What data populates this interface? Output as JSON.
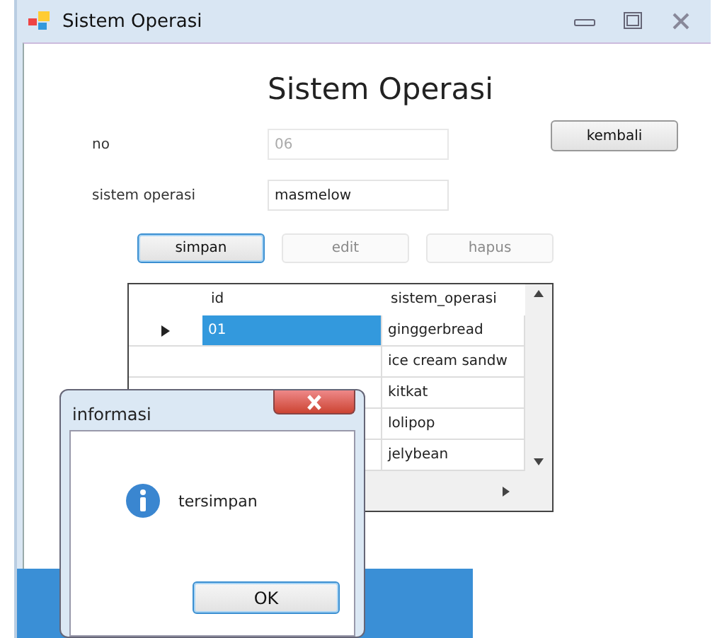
{
  "window": {
    "title": "Sistem Operasi"
  },
  "heading": "Sistem Operasi",
  "fields": [
    {
      "label": "no",
      "value": "06",
      "disabled": true
    },
    {
      "label": "sistem operasi",
      "value": "masmelow",
      "disabled": false
    }
  ],
  "back_button": {
    "label": "kembali"
  },
  "buttons": [
    {
      "label": "simpan",
      "disabled": false,
      "focused": true
    },
    {
      "label": "edit",
      "disabled": true,
      "focused": false
    },
    {
      "label": "hapus",
      "disabled": true,
      "focused": false
    }
  ],
  "table": {
    "columns": [
      "id",
      "sistem_operasi"
    ],
    "rows": [
      {
        "id": "01",
        "sistem_operasi": "ginggerbread",
        "selected": true
      },
      {
        "sistem_operasi": "ice cream sandw",
        "selected": false
      },
      {
        "sistem_operasi": "kitkat",
        "selected": false
      },
      {
        "sistem_operasi": "lolipop",
        "selected": false
      },
      {
        "sistem_operasi": "jelybean",
        "selected": false
      }
    ]
  },
  "dialog": {
    "title": "informasi",
    "message": "tersimpan",
    "button": "OK"
  }
}
